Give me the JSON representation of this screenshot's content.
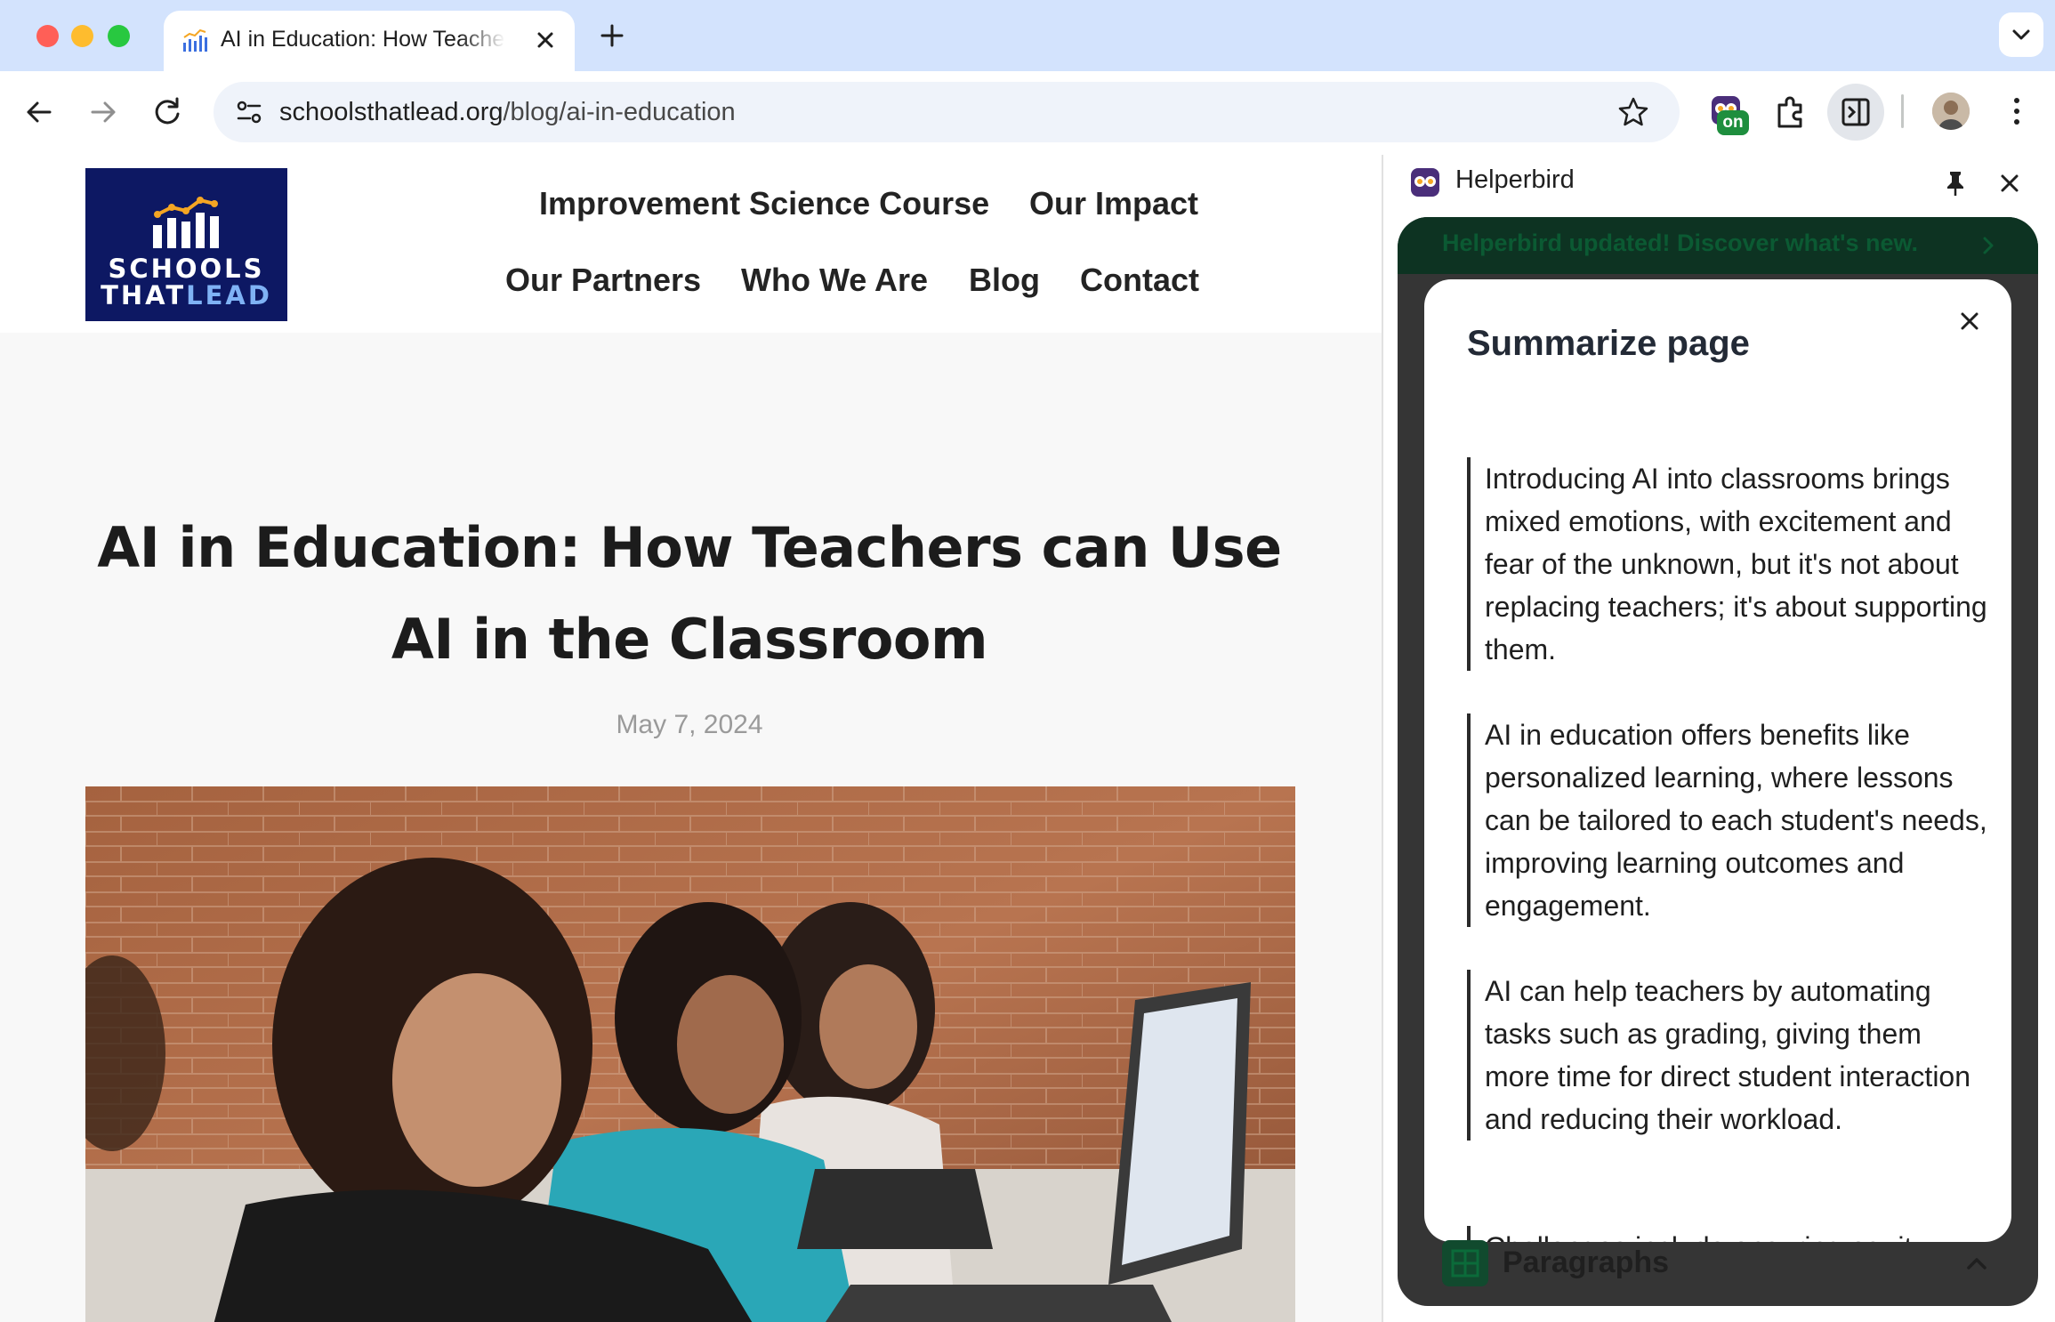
{
  "browser": {
    "tab": {
      "title": "AI in Education: How Teachers can Use AI in the Classroom",
      "favicon": "schoolsthatlead-favicon"
    },
    "omnibox": {
      "domain": "schoolsthatlead.org",
      "path": "/blog/ai-in-education"
    },
    "extension_badge": "on"
  },
  "site": {
    "logo": {
      "line1": "SCHOOLS",
      "line2_a": "THAT",
      "line2_b": "LEAD"
    },
    "nav": [
      "Improvement Science Course",
      "Our Impact",
      "Our Partners",
      "Who We Are",
      "Blog",
      "Contact"
    ]
  },
  "article": {
    "title": "AI in Education: How Teachers can Use AI in the Classroom",
    "date": "May 7, 2024",
    "hero_image": "students-using-laptops-photo"
  },
  "sidepanel": {
    "title": "Helperbird",
    "banner": "Helperbird updated! Discover what's new.",
    "summary": {
      "heading": "Summarize page",
      "paragraphs": [
        "Introducing AI into classrooms brings mixed emotions, with excitement and fear of the unknown, but it's not about replacing teachers; it's about supporting them.",
        "AI in education offers benefits like personalized learning, where lessons can be tailored to each student's needs, improving learning outcomes and engagement.",
        "AI can help teachers by automating tasks such as grading, giving them more time for direct student interaction and reducing their workload.",
        "Challenges include ensuring equity"
      ]
    },
    "footer_label": "Paragraphs"
  },
  "colors": {
    "tabstrip": "#d3e3fd",
    "logo_bg": "#0d1863",
    "logo_accent": "#f5a623",
    "helperbird_frame": "#353535",
    "banner_bg": "#0d3322"
  }
}
